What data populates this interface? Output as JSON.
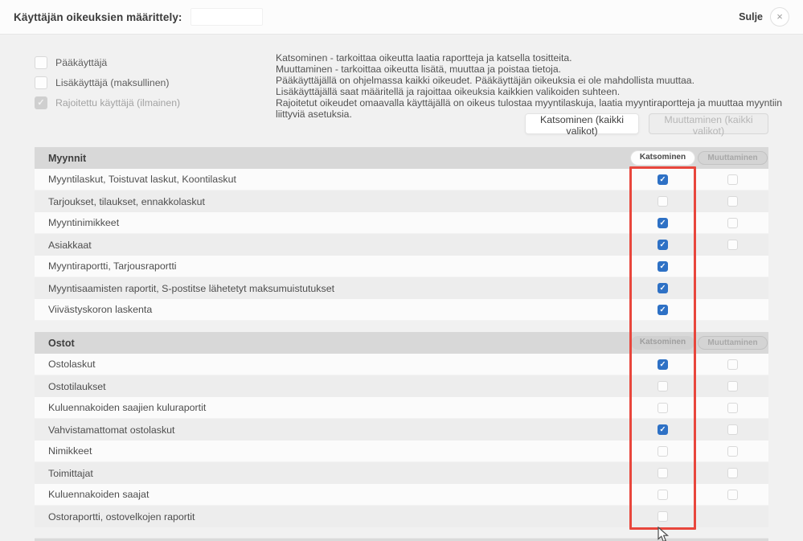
{
  "colors": {
    "accent_blue": "#2e71c5",
    "highlight_red": "#e8463c",
    "section_header_gray": "#d8d8d8"
  },
  "header": {
    "title": "Käyttäjän oikeuksien määrittely:",
    "input_value": "",
    "close_label": "Sulje",
    "close_icon": "×"
  },
  "user_types": [
    {
      "label": "Pääkäyttäjä",
      "state": "unchecked"
    },
    {
      "label": "Lisäkäyttäjä (maksullinen)",
      "state": "unchecked"
    },
    {
      "label": "Rajoitettu käyttäjä (ilmainen)",
      "state": "checked-disabled"
    }
  ],
  "info_lines": [
    "Katsominen - tarkoittaa oikeutta laatia raportteja ja katsella tositteita.",
    "Muuttaminen - tarkoittaa oikeutta lisätä, muuttaa ja poistaa tietoja.",
    "Pääkäyttäjällä on ohjelmassa kaikki oikeudet. Pääkäyttäjän oikeuksia ei ole mahdollista muuttaa.",
    "Lisäkäyttäjällä saat määritellä ja rajoittaa oikeuksia kaikkien valikoiden suhteen.",
    "Rajoitetut oikeudet omaavalla käyttäjällä on oikeus tulostaa myyntilaskuja, laatia myyntiraportteja ja muuttaa myyntiin liittyviä asetuksia."
  ],
  "global_buttons": {
    "katsominen_all": "Katsominen (kaikki valikot)",
    "muuttaminen_all": "Muuttaminen (kaikki valikot)"
  },
  "sections": [
    {
      "title": "Myynnit",
      "pills": {
        "katsominen": "Katsominen",
        "muuttaminen": "Muuttaminen"
      },
      "rows": [
        {
          "label": "Myyntilaskut, Toistuvat laskut, Koontilaskut",
          "katsominen": "checked",
          "muuttaminen": "unchecked"
        },
        {
          "label": "Tarjoukset, tilaukset, ennakkolaskut",
          "katsominen": "unchecked",
          "muuttaminen": "unchecked"
        },
        {
          "label": "Myyntinimikkeet",
          "katsominen": "checked",
          "muuttaminen": "unchecked"
        },
        {
          "label": "Asiakkaat",
          "katsominen": "checked",
          "muuttaminen": "unchecked"
        },
        {
          "label": "Myyntiraportti, Tarjousraportti",
          "katsominen": "checked",
          "muuttaminen": "none"
        },
        {
          "label": "Myyntisaamisten raportit, S-postitse lähetetyt maksumuistutukset",
          "katsominen": "checked",
          "muuttaminen": "none"
        },
        {
          "label": "Viivästyskoron laskenta",
          "katsominen": "checked",
          "muuttaminen": "none"
        }
      ]
    },
    {
      "title": "Ostot",
      "pills": {
        "katsominen": "Katsominen",
        "muuttaminen": "Muuttaminen"
      },
      "rows": [
        {
          "label": "Ostolaskut",
          "katsominen": "checked",
          "muuttaminen": "unchecked"
        },
        {
          "label": "Ostotilaukset",
          "katsominen": "unchecked",
          "muuttaminen": "unchecked"
        },
        {
          "label": "Kuluennakoiden saajien kuluraportit",
          "katsominen": "unchecked",
          "muuttaminen": "unchecked"
        },
        {
          "label": "Vahvistamattomat ostolaskut",
          "katsominen": "checked",
          "muuttaminen": "unchecked"
        },
        {
          "label": "Nimikkeet",
          "katsominen": "unchecked",
          "muuttaminen": "unchecked"
        },
        {
          "label": "Toimittajat",
          "katsominen": "unchecked",
          "muuttaminen": "unchecked"
        },
        {
          "label": "Kuluennakoiden saajat",
          "katsominen": "unchecked",
          "muuttaminen": "unchecked"
        },
        {
          "label": "Ostoraportti, ostovelkojen raportit",
          "katsominen": "unchecked",
          "muuttaminen": "none"
        }
      ]
    }
  ]
}
